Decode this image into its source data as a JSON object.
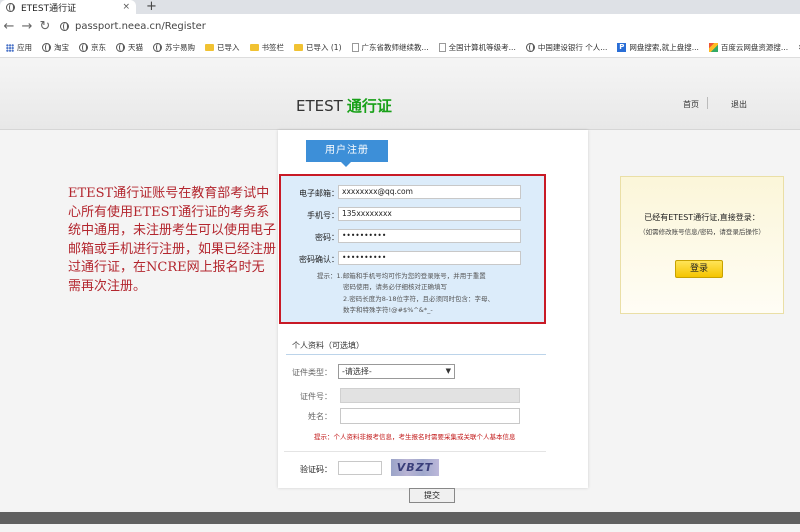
{
  "browser": {
    "tab_title": "ETEST通行证",
    "tab_close": "×",
    "new_tab": "+",
    "back": "←",
    "forward": "→",
    "reload": "↻",
    "url": "passport.neea.cn/Register",
    "bookmarks": [
      "应用",
      "淘宝",
      "京东",
      "天猫",
      "苏宁易购",
      "已导入",
      "书签栏",
      "已导入 (1)",
      "广东省教师继续教...",
      "全国计算机等级考...",
      "中国建设银行 个人...",
      "网盘搜索,就上盘搜...",
      "百度云网盘资源搜..."
    ],
    "more": "»"
  },
  "header": {
    "brand": "ETEST",
    "brand_highlight": "通行证",
    "nav_home": "首页",
    "nav_logout": "退出"
  },
  "register": {
    "tab_label": "用户注册",
    "email_label": "电子邮箱：",
    "email_value": "xxxxxxxx@qq.com",
    "phone_label": "手机号：",
    "phone_value": "135xxxxxxxx",
    "password_label": "密码：",
    "password_value": "••••••••••",
    "confirm_label": "密码确认：",
    "confirm_value": "••••••••••",
    "hint1": "提示：1.邮箱和手机号均可作为您的登录账号，并用于重置",
    "hint2": "密码使用，请务必仔细核对正确填写",
    "hint3": "2.密码长度为8-18位字符，且必须同时包含：字母、",
    "hint4": "数字和特殊字符!@#$%^&*_-"
  },
  "personal": {
    "title": "个人资料（可选填）",
    "idtype_label": "证件类型：",
    "idtype_value": "-请选择-",
    "idnum_label": "证件号：",
    "name_label": "姓名：",
    "note": "提示：个人资料非报考信息，考生报名时需要采集或关联个人基本信息"
  },
  "captcha": {
    "label": "验证码：",
    "image_text": "VBZT"
  },
  "submit_label": "提交",
  "notice": "ETEST通行证账号在教育部考试中心所有使用ETEST通行证的考务系统中通用，未注册考生可以使用电子邮箱或手机进行注册，如果已经注册过通行证，在NCRE网上报名时无需再次注册。",
  "login": {
    "title": "已经有ETEST通行证,直接登录：",
    "subtitle": "（如需修改账号信息/密码，请登录后操作）",
    "button": "登录"
  },
  "colors": {
    "accent_blue": "#3d8fd8",
    "brand_green": "#18a018",
    "warn_red": "#c81a26"
  }
}
